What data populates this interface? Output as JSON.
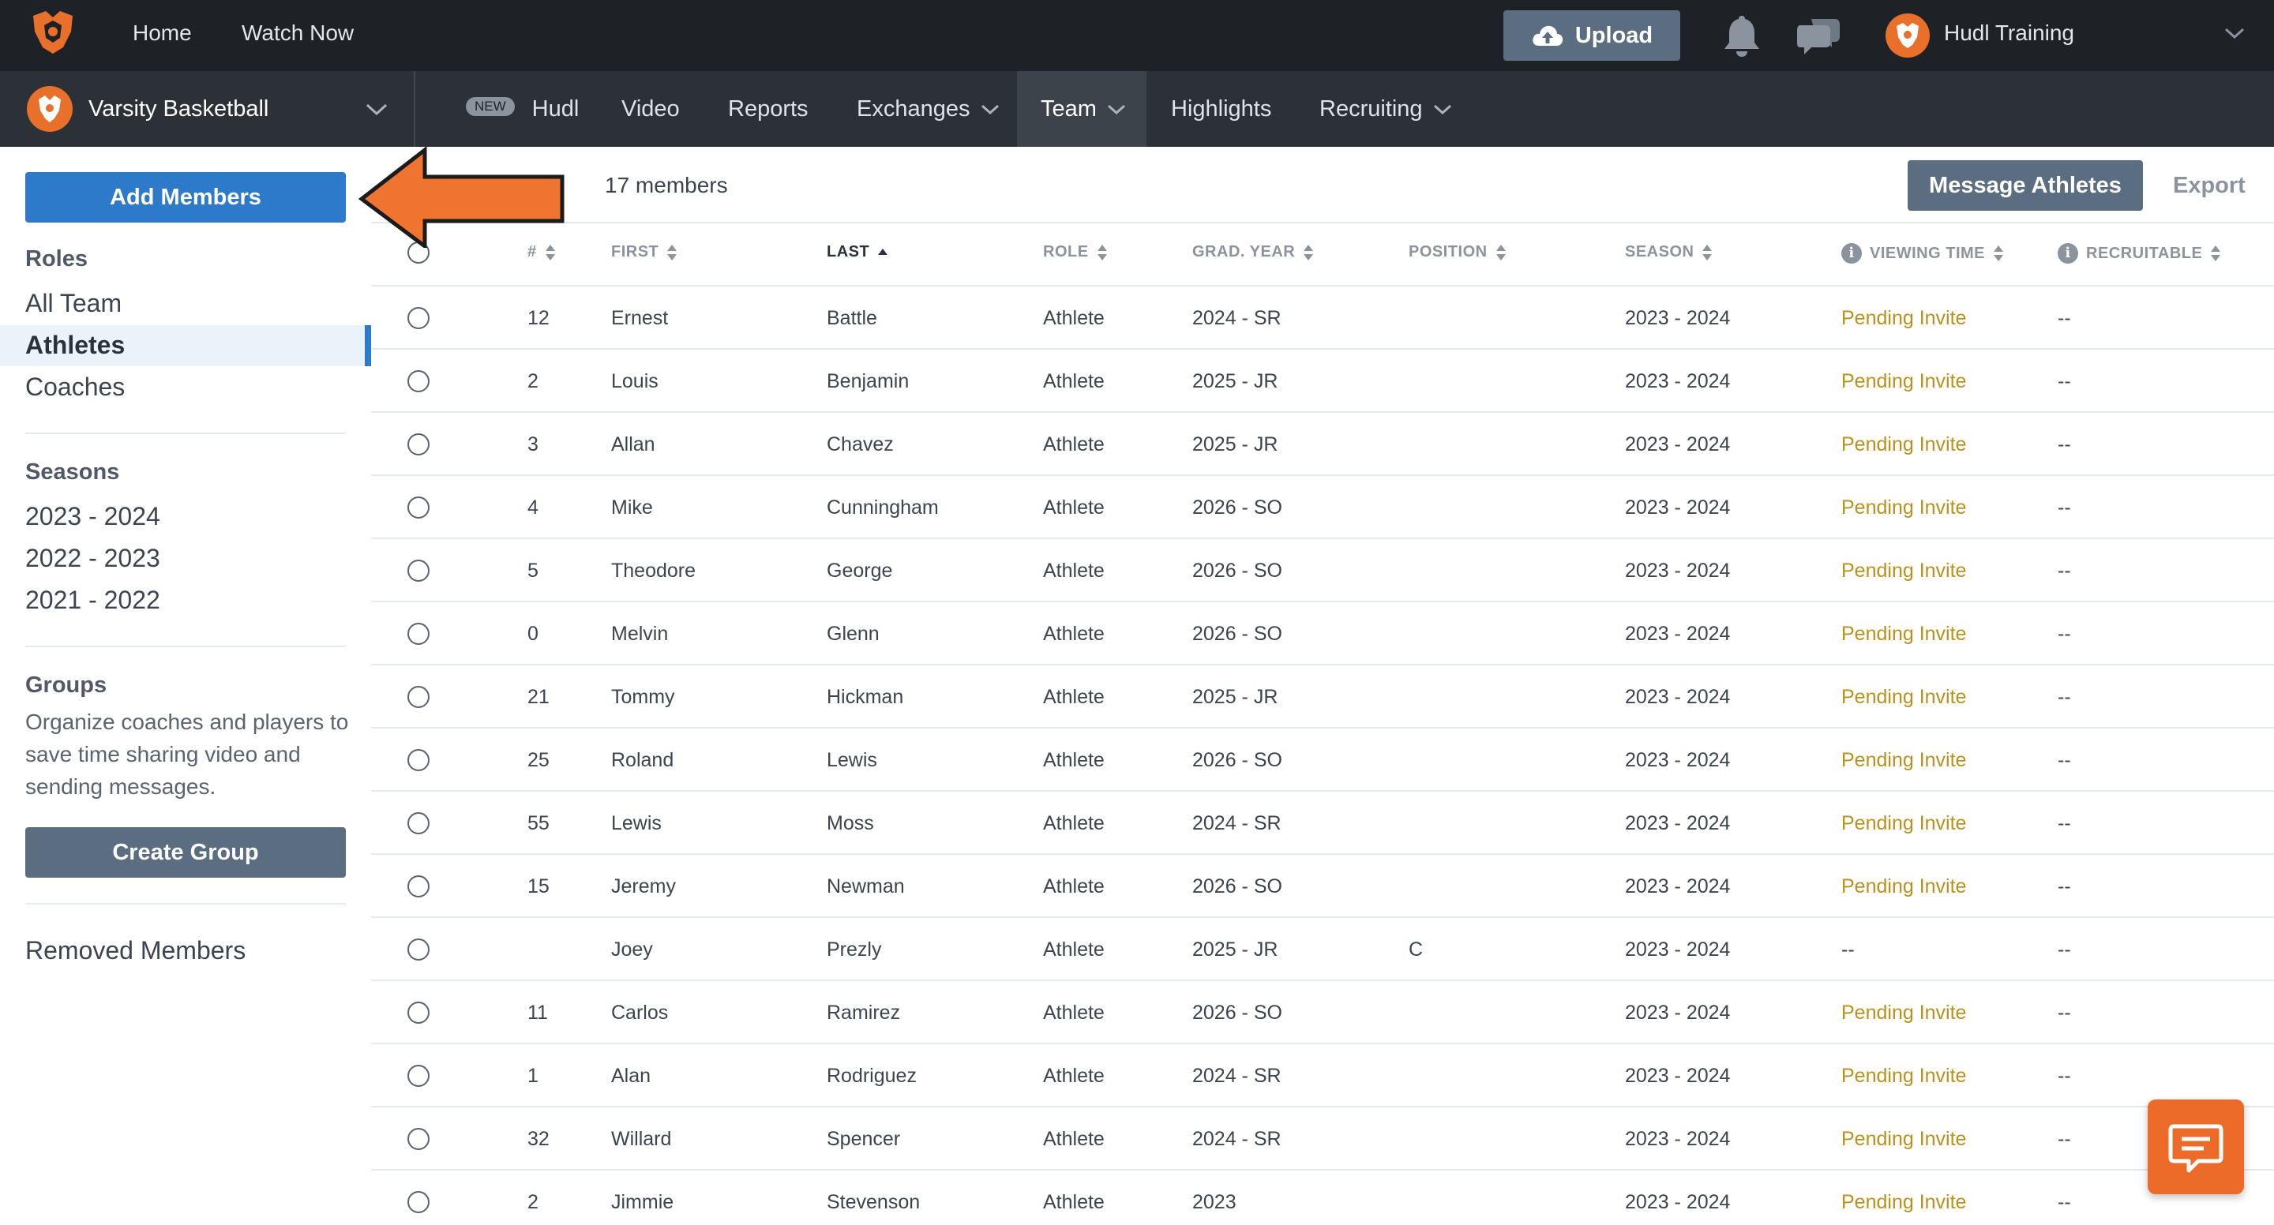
{
  "topbar": {
    "nav": [
      "Home",
      "Watch Now"
    ],
    "upload_label": "Upload",
    "user_name": "Hudl Training"
  },
  "team_selector": {
    "name": "Varsity Basketball"
  },
  "subnav": {
    "new_badge": "NEW",
    "items": [
      "Hudl",
      "Video",
      "Reports",
      "Exchanges",
      "Team",
      "Highlights",
      "Recruiting"
    ],
    "active": "Team"
  },
  "sidebar": {
    "add_members_label": "Add Members",
    "roles_heading": "Roles",
    "roles": [
      "All Team",
      "Athletes",
      "Coaches"
    ],
    "selected_role": "Athletes",
    "seasons_heading": "Seasons",
    "seasons": [
      "2023 - 2024",
      "2022 - 2023",
      "2021 - 2022"
    ],
    "groups_heading": "Groups",
    "groups_description": "Organize coaches and players to save time sharing video and sending messages.",
    "create_group_label": "Create Group",
    "removed_members_label": "Removed Members"
  },
  "toolbar": {
    "members_count": "17 members",
    "message_label": "Message Athletes",
    "export_label": "Export"
  },
  "table": {
    "headers": {
      "number": "#",
      "first": "FIRST",
      "last": "LAST",
      "role": "ROLE",
      "grad_year": "GRAD. YEAR",
      "position": "POSITION",
      "season": "SEASON",
      "viewing_time": "VIEWING TIME",
      "recruitable": "RECRUITABLE"
    },
    "sorted_by": "LAST",
    "sort_direction": "ascending",
    "rows": [
      {
        "number": "12",
        "first": "Ernest",
        "last": "Battle",
        "role": "Athlete",
        "grad_year": "2024 - SR",
        "position": "",
        "season": "2023 - 2024",
        "viewing_time": "Pending Invite",
        "recruitable": "--"
      },
      {
        "number": "2",
        "first": "Louis",
        "last": "Benjamin",
        "role": "Athlete",
        "grad_year": "2025 - JR",
        "position": "",
        "season": "2023 - 2024",
        "viewing_time": "Pending Invite",
        "recruitable": "--"
      },
      {
        "number": "3",
        "first": "Allan",
        "last": "Chavez",
        "role": "Athlete",
        "grad_year": "2025 - JR",
        "position": "",
        "season": "2023 - 2024",
        "viewing_time": "Pending Invite",
        "recruitable": "--"
      },
      {
        "number": "4",
        "first": "Mike",
        "last": "Cunningham",
        "role": "Athlete",
        "grad_year": "2026 - SO",
        "position": "",
        "season": "2023 - 2024",
        "viewing_time": "Pending Invite",
        "recruitable": "--"
      },
      {
        "number": "5",
        "first": "Theodore",
        "last": "George",
        "role": "Athlete",
        "grad_year": "2026 - SO",
        "position": "",
        "season": "2023 - 2024",
        "viewing_time": "Pending Invite",
        "recruitable": "--"
      },
      {
        "number": "0",
        "first": "Melvin",
        "last": "Glenn",
        "role": "Athlete",
        "grad_year": "2026 - SO",
        "position": "",
        "season": "2023 - 2024",
        "viewing_time": "Pending Invite",
        "recruitable": "--"
      },
      {
        "number": "21",
        "first": "Tommy",
        "last": "Hickman",
        "role": "Athlete",
        "grad_year": "2025 - JR",
        "position": "",
        "season": "2023 - 2024",
        "viewing_time": "Pending Invite",
        "recruitable": "--"
      },
      {
        "number": "25",
        "first": "Roland",
        "last": "Lewis",
        "role": "Athlete",
        "grad_year": "2026 - SO",
        "position": "",
        "season": "2023 - 2024",
        "viewing_time": "Pending Invite",
        "recruitable": "--"
      },
      {
        "number": "55",
        "first": "Lewis",
        "last": "Moss",
        "role": "Athlete",
        "grad_year": "2024 - SR",
        "position": "",
        "season": "2023 - 2024",
        "viewing_time": "Pending Invite",
        "recruitable": "--"
      },
      {
        "number": "15",
        "first": "Jeremy",
        "last": "Newman",
        "role": "Athlete",
        "grad_year": "2026 - SO",
        "position": "",
        "season": "2023 - 2024",
        "viewing_time": "Pending Invite",
        "recruitable": "--"
      },
      {
        "number": "",
        "first": "Joey",
        "last": "Prezly",
        "role": "Athlete",
        "grad_year": "2025 - JR",
        "position": "C",
        "season": "2023 - 2024",
        "viewing_time": "--",
        "recruitable": "--"
      },
      {
        "number": "11",
        "first": "Carlos",
        "last": "Ramirez",
        "role": "Athlete",
        "grad_year": "2026 - SO",
        "position": "",
        "season": "2023 - 2024",
        "viewing_time": "Pending Invite",
        "recruitable": "--"
      },
      {
        "number": "1",
        "first": "Alan",
        "last": "Rodriguez",
        "role": "Athlete",
        "grad_year": "2024 - SR",
        "position": "",
        "season": "2023 - 2024",
        "viewing_time": "Pending Invite",
        "recruitable": "--"
      },
      {
        "number": "32",
        "first": "Willard",
        "last": "Spencer",
        "role": "Athlete",
        "grad_year": "2024 - SR",
        "position": "",
        "season": "2023 - 2024",
        "viewing_time": "Pending Invite",
        "recruitable": "--"
      },
      {
        "number": "2",
        "first": "Jimmie",
        "last": "Stevenson",
        "role": "Athlete",
        "grad_year": "2023",
        "position": "",
        "season": "2023 - 2024",
        "viewing_time": "Pending Invite",
        "recruitable": "--"
      }
    ]
  },
  "icons": {
    "logo": "hudl-logo-icon",
    "upload": "cloud-upload-icon",
    "notifications": "bell-icon",
    "messages": "chat-bubbles-icon",
    "help": "help-chat-icon",
    "annotation": "orange-arrow-pointer"
  },
  "colors": {
    "brand_orange": "#e8702b",
    "primary_blue": "#2c7ac9",
    "secondary_slate": "#5b6d80",
    "pending_gold": "#b9911b",
    "topbar": "#1e2227",
    "subbar": "#2c3138"
  }
}
